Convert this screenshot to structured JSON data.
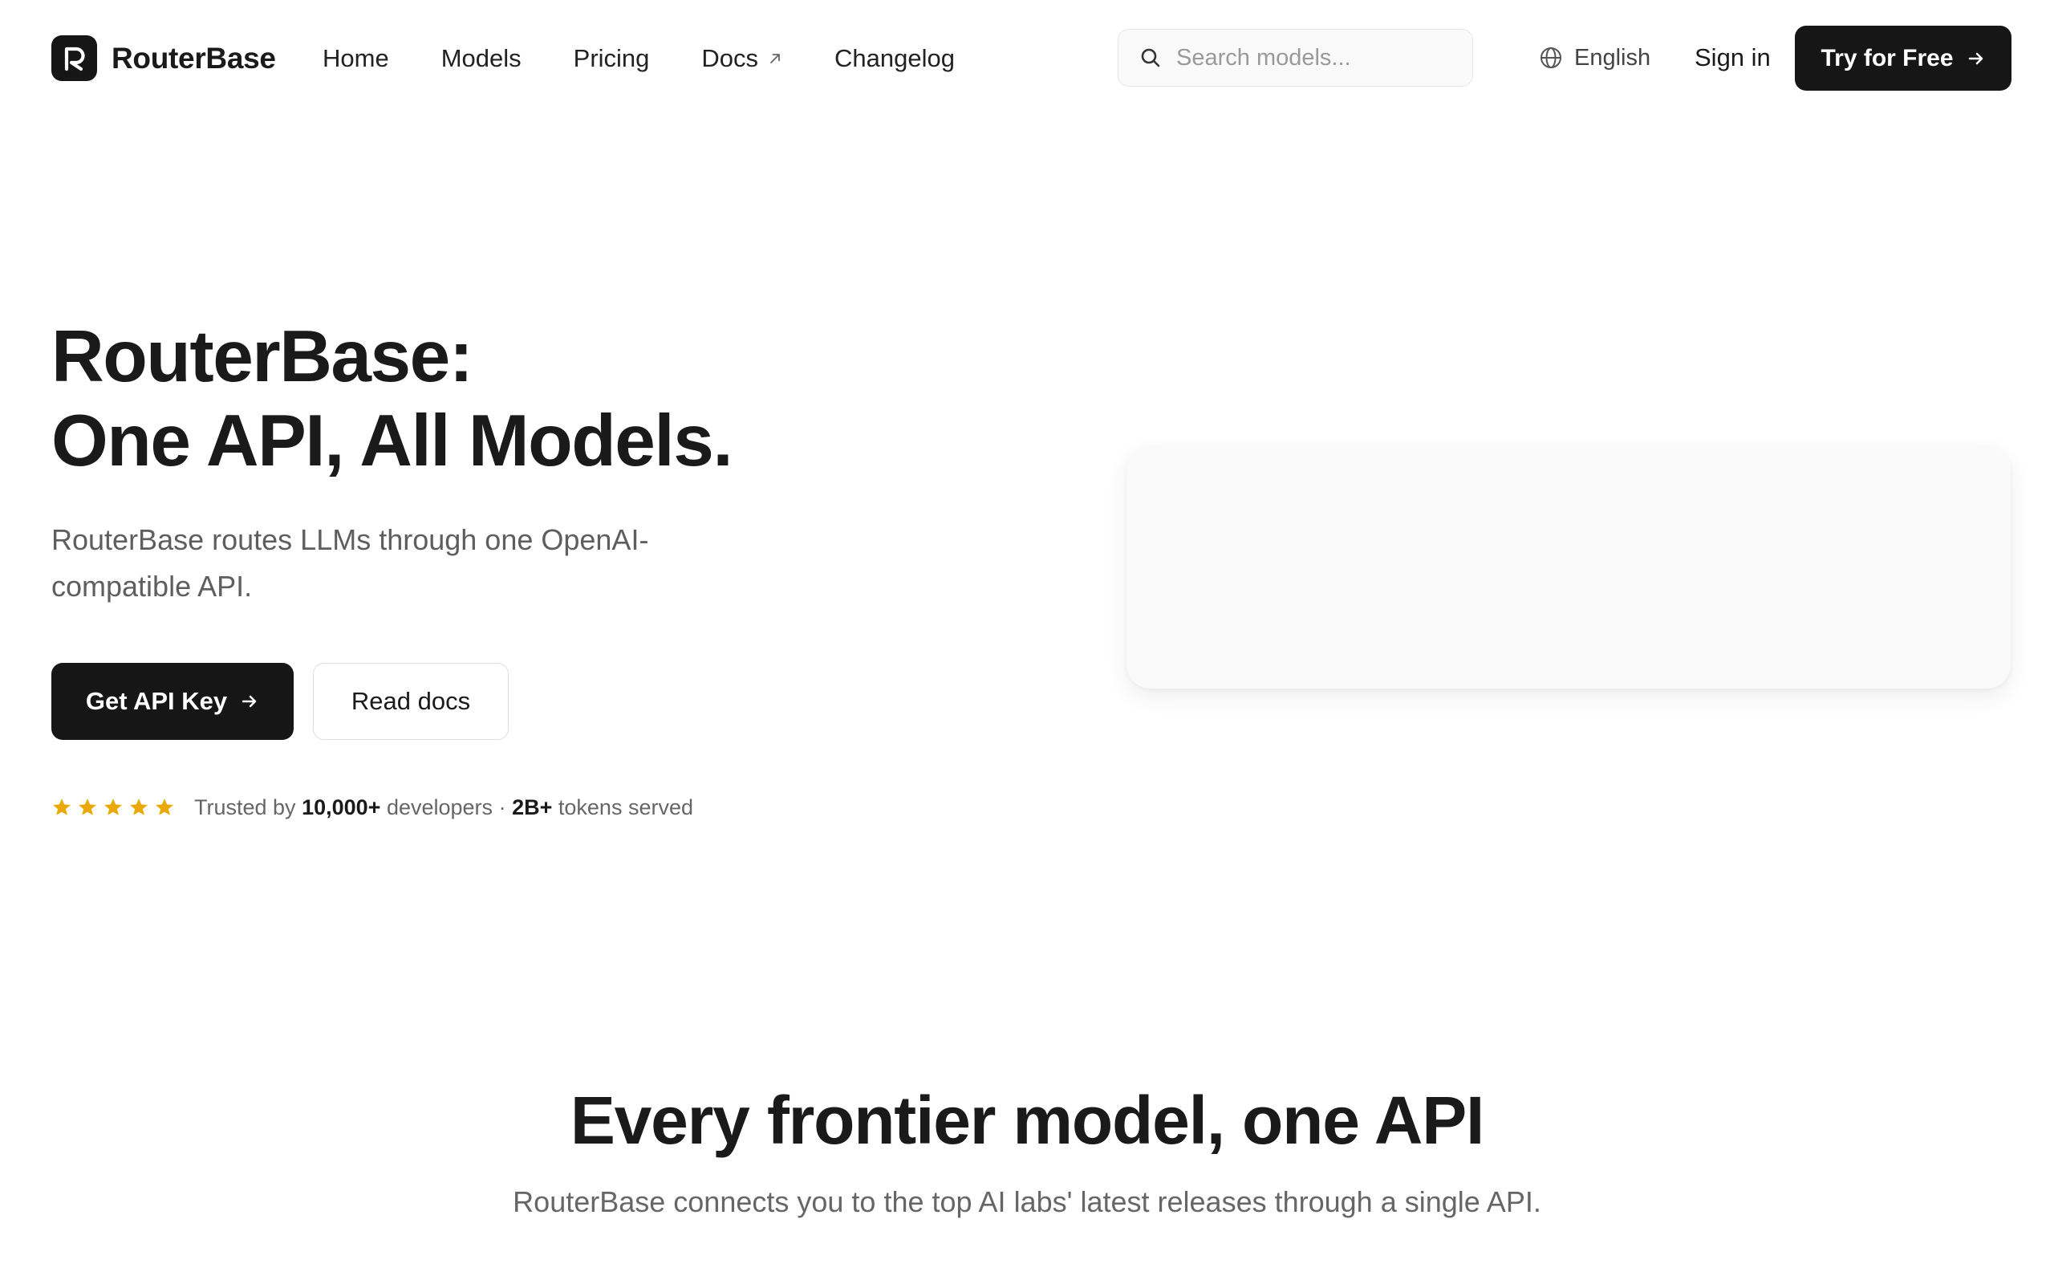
{
  "brand": {
    "name": "RouterBase"
  },
  "nav": {
    "items": [
      {
        "label": "Home"
      },
      {
        "label": "Models"
      },
      {
        "label": "Pricing"
      },
      {
        "label": "Docs",
        "external_icon": "arrow-up-right-icon"
      },
      {
        "label": "Changelog"
      }
    ]
  },
  "search": {
    "placeholder": "Search models...",
    "value": "",
    "icon": "search-icon"
  },
  "language": {
    "label": "English",
    "icon": "globe-icon"
  },
  "auth": {
    "signin_label": "Sign in",
    "cta_label": "Try for Free"
  },
  "hero": {
    "title_line1": "RouterBase:",
    "title_line2": "One API, All Models.",
    "subtitle": "RouterBase routes LLMs through one OpenAI-compatible API.",
    "primary_cta": "Get API Key",
    "secondary_cta": "Read docs",
    "rating_stars": 5,
    "trust": {
      "prefix": "Trusted by",
      "developers_count": "10,000+",
      "developers_label": "developers",
      "separator": "·",
      "tokens_count": "2B+",
      "tokens_label": "tokens served"
    }
  },
  "section": {
    "title": "Every frontier model, one API",
    "subtitle": "RouterBase connects you to the top AI labs' latest releases through a single API."
  },
  "colors": {
    "primary": "#161616",
    "text": "#1a1a1a",
    "muted": "#666666",
    "star": "#e8a909",
    "border": "#e6e6e6",
    "card_bg": "#fafafa"
  }
}
